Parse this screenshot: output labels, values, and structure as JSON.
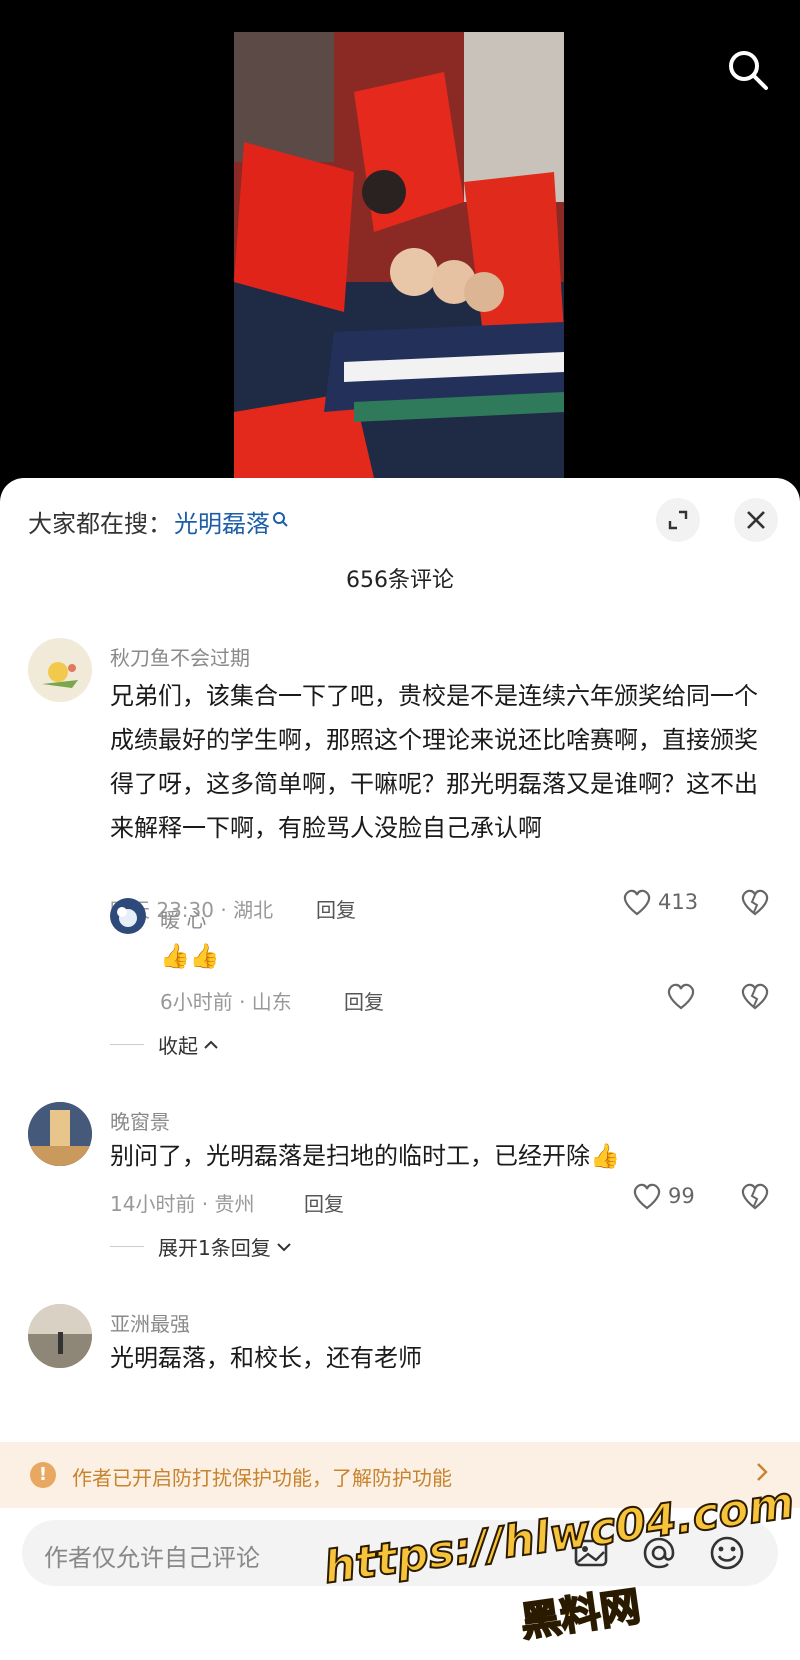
{
  "hot_search": {
    "prefix": "大家都在搜：",
    "keyword": "光明磊落"
  },
  "comment_count": "656条评论",
  "comments": [
    {
      "author": "秋刀鱼不会过期",
      "text": "兄弟们，该集合一下了吧，贵校是不是连续六年颁奖给同一个成绩最好的学生啊，那照这个理论来说还比啥赛啊，直接颁奖得了呀，这多简单啊，干嘛呢？那光明磊落又是谁啊？这不出来解释一下啊，有脸骂人没脸自己承认啊",
      "time": "昨天 23:30 · 湖北",
      "reply": "回复",
      "likes": "413",
      "reply_item": {
        "author": "暖 心",
        "text": "👍👍",
        "time": "6小时前 · 山东",
        "reply": "回复"
      },
      "toggle": "收起"
    },
    {
      "author": "晚窗景",
      "text": "别问了，光明磊落是扫地的临时工，已经开除👍",
      "time": "14小时前 · 贵州",
      "reply": "回复",
      "likes": "99",
      "toggle": "展开1条回复"
    },
    {
      "author": "亚洲最强",
      "text": "光明磊落，和校长，还有老师"
    }
  ],
  "notice": {
    "text": "作者已开启防打扰保护功能，了解防护功能",
    "icon": "exclamation-icon"
  },
  "input": {
    "placeholder": "作者仅允许自己评论"
  },
  "watermark": {
    "url": "https://hlwc04.com",
    "name": "黑料网"
  },
  "colors": {
    "link_blue": "#1d5ea8",
    "notice_bg": "#fbf0e3",
    "notice_text": "#c8832e",
    "watermark": "#f6c33a"
  }
}
